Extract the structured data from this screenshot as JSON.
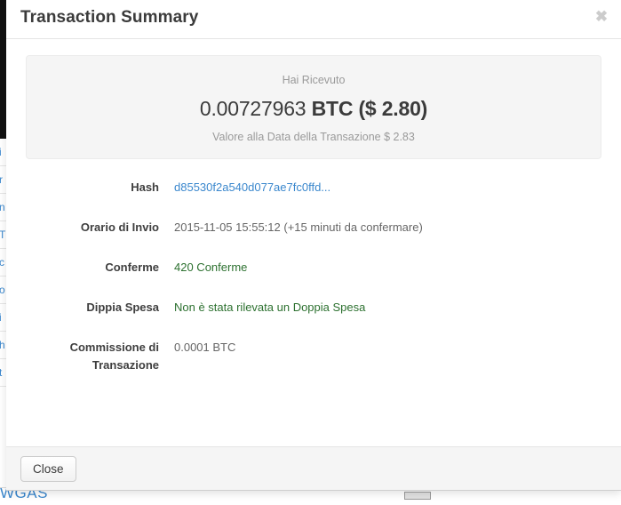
{
  "background": {
    "left_column_rows": [
      "i",
      "r",
      "n",
      "T",
      "c",
      "o",
      "i",
      "h",
      "t"
    ],
    "bottom_text": "WGAS"
  },
  "modal": {
    "title": "Transaction Summary",
    "close_icon": "close-icon",
    "close_glyph": "✖",
    "summary": {
      "lead": "Hai Ricevuto",
      "amount_value": "0.00727963",
      "amount_unit": "BTC ($ 2.80)",
      "sub": "Valore alla Data della Transazione $ 2.83"
    },
    "details": [
      {
        "label": "Hash",
        "value": "d85530f2a540d077ae7fc0ffd...",
        "style": "link",
        "name": "hash"
      },
      {
        "label": "Orario di Invio",
        "value": "2015-11-05 15:55:12 (+15 minuti da confermare)",
        "style": "plain",
        "name": "sent-time"
      },
      {
        "label": "Conferme",
        "value": "420 Conferme",
        "style": "green",
        "name": "confirmations"
      },
      {
        "label": "Dippia Spesa",
        "value": "Non è stata rilevata un Doppia Spesa",
        "style": "green",
        "name": "double-spend"
      },
      {
        "label": "Commissione di Transazione",
        "value": "0.0001 BTC",
        "style": "plain",
        "name": "transaction-fee"
      }
    ],
    "footer": {
      "close_button": "Close"
    }
  },
  "colors": {
    "link": "#3a87cd",
    "success": "#2d7130",
    "muted": "#9a9a9a",
    "label": "#3f3f3f",
    "well_bg": "#f5f5f5"
  }
}
